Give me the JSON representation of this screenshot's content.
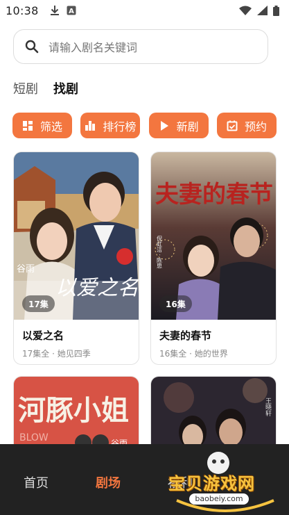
{
  "status_bar": {
    "time": "10:38",
    "a_label": "A"
  },
  "search": {
    "placeholder": "请输入剧名关键词"
  },
  "tabs": [
    {
      "label": "短剧",
      "active": false
    },
    {
      "label": "找剧",
      "active": true
    }
  ],
  "chips": [
    {
      "label": "筛选",
      "icon": "grid-icon"
    },
    {
      "label": "排行榜",
      "icon": "bar-chart-icon"
    },
    {
      "label": "新剧",
      "icon": "play-icon"
    },
    {
      "label": "预约",
      "icon": "calendar-check-icon"
    }
  ],
  "cards": [
    {
      "title": "以爱之名",
      "meta": "17集全 · 她见四季",
      "episodes": "17集",
      "poster_title": "以爱之名",
      "poster_brand": "谷雨"
    },
    {
      "title": "夫妻的春节",
      "meta": "16集全 · 她的世界",
      "episodes": "16集",
      "poster_title": "夫妻的春节",
      "poster_sub": "倪虹洁 · 陈思"
    }
  ],
  "cards_row2": [
    {
      "poster_title": "河豚小姐",
      "poster_sub": "BLOW",
      "poster_brand": "谷雨"
    },
    {
      "poster_title": "",
      "poster_sub": "王晓轩"
    }
  ],
  "bottom_nav": [
    {
      "label": "首页",
      "active": false
    },
    {
      "label": "剧场",
      "active": true
    },
    {
      "label": "福利",
      "active": false
    }
  ],
  "watermark": {
    "text": "宝贝游戏网",
    "url": "baobeiy.com"
  },
  "colors": {
    "accent": "#f3763f",
    "nav_bg": "#222222"
  }
}
